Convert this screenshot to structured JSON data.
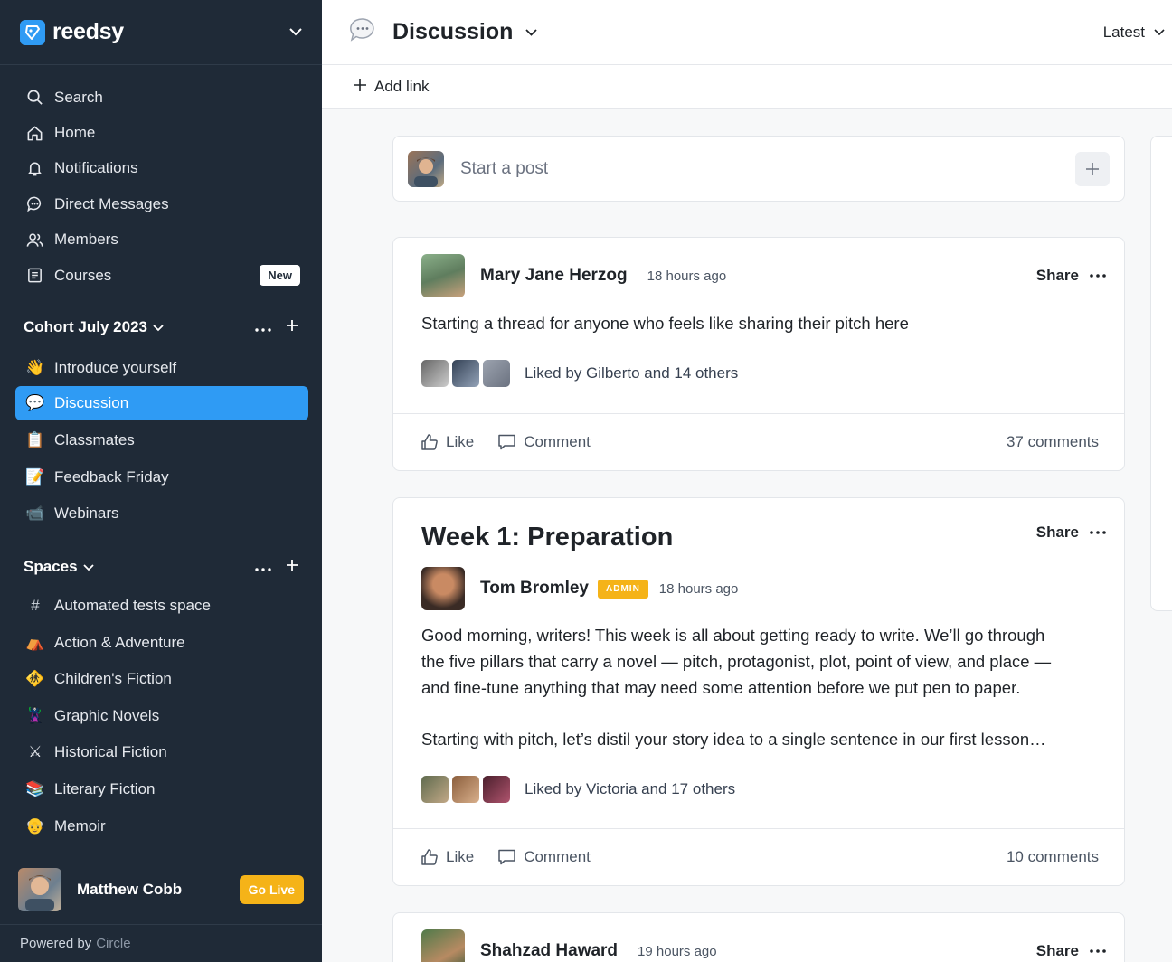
{
  "sidebar": {
    "brand": "reedsy",
    "nav": [
      {
        "label": "Search",
        "icon": "search-icon"
      },
      {
        "label": "Home",
        "icon": "home-icon"
      },
      {
        "label": "Notifications",
        "icon": "bell-icon"
      },
      {
        "label": "Direct Messages",
        "icon": "chat-icon"
      },
      {
        "label": "Members",
        "icon": "members-icon"
      },
      {
        "label": "Courses",
        "icon": "courses-icon",
        "badge": "New"
      }
    ],
    "group1": {
      "title": "Cohort July 2023",
      "items": [
        {
          "emoji": "👋",
          "label": "Introduce yourself"
        },
        {
          "emoji": "💬",
          "label": "Discussion",
          "active": true
        },
        {
          "emoji": "📋",
          "label": "Classmates"
        },
        {
          "emoji": "📝",
          "label": "Feedback Friday"
        },
        {
          "emoji": "📹",
          "label": "Webinars"
        }
      ]
    },
    "group2": {
      "title": "Spaces",
      "items": [
        {
          "emoji": "#",
          "label": "Automated tests space"
        },
        {
          "emoji": "⛺",
          "label": "Action & Adventure"
        },
        {
          "emoji": "🚸",
          "label": "Children's Fiction"
        },
        {
          "emoji": "🦹",
          "label": "Graphic Novels"
        },
        {
          "emoji": "⚔",
          "label": "Historical Fiction"
        },
        {
          "emoji": "📚",
          "label": "Literary Fiction"
        },
        {
          "emoji": "👴",
          "label": "Memoir"
        }
      ]
    },
    "user": {
      "name": "Matthew Cobb",
      "go_live": "Go Live"
    },
    "powered": {
      "prefix": "Powered by",
      "brand": "Circle"
    }
  },
  "header": {
    "title": "Discussion",
    "sort": "Latest"
  },
  "subbar": {
    "add_link": "Add link"
  },
  "composer": {
    "placeholder": "Start a post"
  },
  "posts": [
    {
      "author": "Mary Jane Herzog",
      "time": "18 hours ago",
      "share": "Share",
      "text": "Starting a thread for anyone who feels like sharing their pitch here",
      "liked_by": "Liked by Gilberto and 14 others",
      "like": "Like",
      "comment": "Comment",
      "comments": "37 comments"
    },
    {
      "title": "Week 1: Preparation",
      "author": "Tom Bromley",
      "role": "ADMIN",
      "time": "18 hours ago",
      "share": "Share",
      "paragraph1_line1": "Good morning, writers! This week is all about getting ready to write. We’ll go through",
      "paragraph1_line2": "the five pillars that carry a novel — pitch, protagonist, plot, point of view, and place —",
      "paragraph1_line3": "and fine-tune anything that may need some attention before we put pen to paper.",
      "paragraph2": "Starting with pitch, let’s distil your story idea to a single sentence in our first lesson…",
      "liked_by": "Liked by Victoria and 17 others",
      "like": "Like",
      "comment": "Comment",
      "comments": "10 comments"
    },
    {
      "author": "Shahzad Haward",
      "time": "19 hours ago",
      "share": "Share"
    }
  ],
  "colors": {
    "sidebar_bg": "#1f2a37",
    "accent": "#2f9bf4",
    "admin_badge": "#f5b318"
  }
}
